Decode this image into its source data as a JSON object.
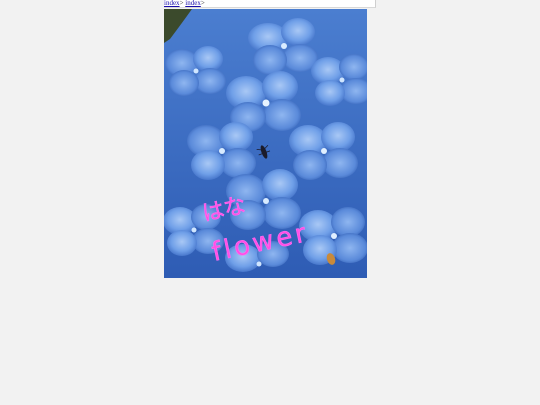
{
  "breadcrumb": {
    "links": [
      "index",
      "index"
    ],
    "separator": ">"
  },
  "photo": {
    "subject": "blue hydrangea petals",
    "overlay_line1": "はな",
    "overlay_line2": "flower",
    "overlay_color": "#ff4fe6"
  }
}
